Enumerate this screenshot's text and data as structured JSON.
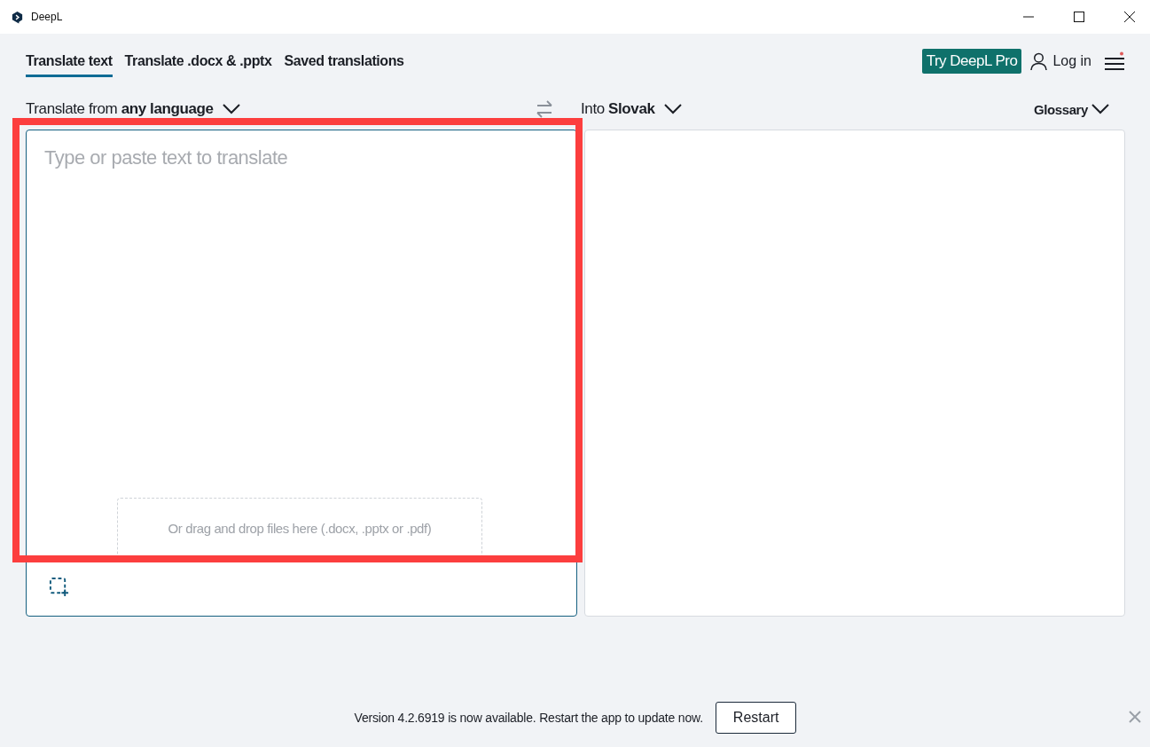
{
  "window": {
    "title": "DeepL"
  },
  "tabs": [
    {
      "label": "Translate text",
      "selected": true
    },
    {
      "label": "Translate .docx & .pptx",
      "selected": false
    },
    {
      "label": "Saved translations",
      "selected": false
    }
  ],
  "header": {
    "pro_button": "Try DeepL Pro",
    "login": "Log in",
    "menu_notification": true
  },
  "source": {
    "language": "Translate from **any language**",
    "placeholder": "Type or paste text to translate",
    "drop_hint": "Or drag and drop files here (.docx, .pptx or .pdf)"
  },
  "target": {
    "language": "Into **Slovak**",
    "glossary": "Glossary"
  },
  "update_bar": {
    "message": "Version 4.2.6919 is now available. Restart the app to update now.",
    "button": "Restart"
  }
}
